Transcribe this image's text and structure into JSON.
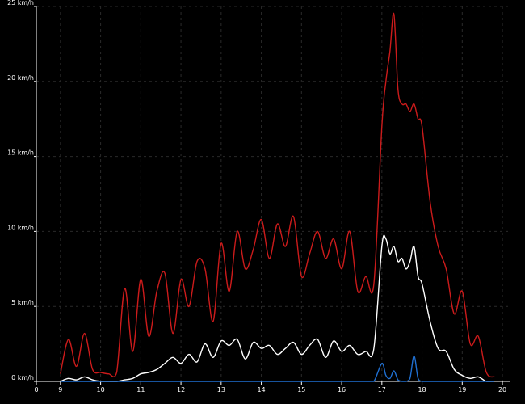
{
  "chart_data": {
    "type": "line",
    "x": [
      9,
      9.2,
      9.4,
      9.6,
      9.8,
      10,
      10.2,
      10.4,
      10.6,
      10.8,
      11,
      11.2,
      11.4,
      11.6,
      11.8,
      12,
      12.2,
      12.4,
      12.6,
      12.8,
      13,
      13.2,
      13.4,
      13.6,
      13.8,
      14,
      14.2,
      14.4,
      14.6,
      14.8,
      15,
      15.2,
      15.4,
      15.6,
      15.8,
      16,
      16.2,
      16.4,
      16.6,
      16.8,
      17,
      17.1,
      17.2,
      17.3,
      17.4,
      17.5,
      17.6,
      17.7,
      17.8,
      17.9,
      18,
      18.2,
      18.4,
      18.6,
      18.8,
      19,
      19.2,
      19.4,
      19.6,
      19.8
    ],
    "series": [
      {
        "color": "#cc1b1b",
        "values": [
          0.5,
          2.8,
          1.0,
          3.2,
          0.8,
          0.6,
          0.5,
          0.6,
          6.2,
          2.0,
          6.8,
          3.0,
          6.0,
          7.2,
          3.2,
          6.8,
          5.0,
          8.0,
          7.5,
          4.0,
          9.2,
          6.0,
          10.0,
          7.5,
          8.8,
          10.8,
          8.2,
          10.5,
          9.0,
          11.0,
          7.0,
          8.5,
          10.0,
          8.2,
          9.5,
          7.5,
          10.0,
          6.0,
          7.0,
          6.5,
          17.0,
          20.0,
          22.0,
          24.5,
          19.5,
          18.5,
          18.5,
          18.0,
          18.5,
          17.5,
          17.0,
          12.0,
          9.0,
          7.5,
          4.5,
          6.0,
          2.5,
          3.0,
          0.6,
          0.3
        ]
      },
      {
        "color": "#ffffff",
        "values": [
          0,
          0.2,
          0.1,
          0.3,
          0.1,
          0,
          0,
          0,
          0.1,
          0.2,
          0.5,
          0.6,
          0.8,
          1.2,
          1.6,
          1.2,
          1.8,
          1.3,
          2.5,
          1.6,
          2.7,
          2.4,
          2.8,
          1.5,
          2.6,
          2.2,
          2.4,
          1.8,
          2.2,
          2.6,
          1.8,
          2.4,
          2.8,
          1.6,
          2.7,
          2.0,
          2.4,
          1.8,
          2.0,
          2.2,
          9.0,
          9.5,
          8.5,
          9.0,
          8.0,
          8.2,
          7.5,
          8.0,
          9.0,
          7.0,
          6.5,
          4.0,
          2.2,
          2.0,
          0.8,
          0.4,
          0.2,
          0.3,
          0,
          0
        ]
      },
      {
        "color": "#1f6fd1",
        "values": [
          0,
          0,
          0,
          0,
          0,
          0,
          0,
          0,
          0,
          0,
          0,
          0,
          0,
          0,
          0,
          0,
          0,
          0,
          0,
          0,
          0,
          0,
          0,
          0,
          0,
          0,
          0,
          0,
          0,
          0,
          0,
          0,
          0,
          0,
          0,
          0,
          0,
          0,
          0,
          0,
          1.2,
          0.4,
          0.2,
          0.7,
          0.1,
          0,
          0,
          0.2,
          1.7,
          0.2,
          0,
          0,
          0,
          0,
          0,
          0,
          0,
          0,
          0,
          0
        ]
      }
    ],
    "xticks": [
      0,
      9,
      10,
      11,
      12,
      13,
      14,
      15,
      16,
      17,
      18,
      19,
      20
    ],
    "yticks": [
      {
        "value": 0,
        "label": "0 km/h"
      },
      {
        "value": 5,
        "label": "5 km/h"
      },
      {
        "value": 10,
        "label": "10 km/h"
      },
      {
        "value": 15,
        "label": "15 km/h"
      },
      {
        "value": 20,
        "label": "20 km/h"
      },
      {
        "value": 25,
        "label": "25 km/h"
      }
    ],
    "ylim": [
      0,
      25
    ],
    "xlim": [
      8.4,
      20.2
    ],
    "grid": true,
    "background": "#000000",
    "grid_color": "#2a2a2a",
    "axis_color": "#ffffff"
  }
}
